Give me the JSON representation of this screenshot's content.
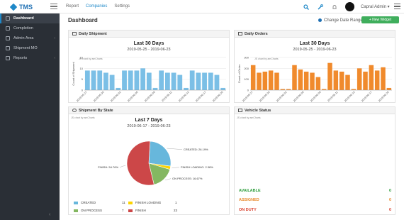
{
  "topbar": {
    "brand": "TMS",
    "nav": [
      "Report",
      "Companies",
      "Settings"
    ],
    "user": "Capral Admin ▾"
  },
  "sidebar": {
    "items": [
      {
        "label": "Dashboard",
        "active": true
      },
      {
        "label": "Completion"
      },
      {
        "label": "Admin Area",
        "chevron": "‹"
      },
      {
        "label": "Shipment MO"
      },
      {
        "label": "Reports",
        "chevron": "‹"
      }
    ],
    "collapse": "‹"
  },
  "header": {
    "title": "Dashboard",
    "date_range": "Change Date Range ▾",
    "new_widget": "+ New Widget"
  },
  "panels": {
    "daily_shipment": {
      "header": "Daily Shipment",
      "title": "Last 30 Days",
      "subtitle": "2019-05-25 - 2019-06-23",
      "credit": "JS chart by amCharts"
    },
    "daily_orders": {
      "header": "Daily Orders",
      "title": "Last 30 Days",
      "subtitle": "2019-05-25 - 2019-06-23",
      "credit": "JS chart by amCharts"
    },
    "shipment_by_state": {
      "header": "Shipment By State",
      "title": "Last 7 Days",
      "subtitle": "2019-06-17 - 2019-06-23",
      "credit": "JS chart by amCharts"
    },
    "vehicle_status": {
      "header": "Vehicle Status",
      "credit": "JS chart by amCharts",
      "rows": [
        {
          "label": "AVAILABLE",
          "value": "0",
          "color": "#2e9e3d"
        },
        {
          "label": "ASSIGNED",
          "value": "0",
          "color": "#e8892b"
        },
        {
          "label": "ON DUTY",
          "value": "0",
          "color": "#d9412e"
        }
      ]
    }
  },
  "chart_data": [
    {
      "type": "bar",
      "ylabel": "Count of Shipment",
      "ylim": [
        0,
        15
      ],
      "yticks": [
        "0",
        "5",
        "10",
        "15"
      ],
      "color": "#7bbfe6",
      "xticks": [
        "2019-05-27",
        "2019-05-30",
        "2019-06-02",
        "2019-06-05",
        "2019-06-08",
        "2019-06-11",
        "2019-06-14",
        "2019-06-17",
        "2019-06-20"
      ],
      "values": [
        9,
        9,
        9,
        8,
        7,
        1,
        9,
        9,
        9,
        10,
        8,
        1,
        9,
        8,
        8,
        7,
        1,
        9,
        8,
        8,
        8,
        7,
        1
      ]
    },
    {
      "type": "bar",
      "ylabel": "Count of Order",
      "ylim": [
        0,
        300
      ],
      "yticks": [
        "0",
        "100",
        "200",
        "300"
      ],
      "color": "#f08a2c",
      "xticks": [
        "2019-05-27",
        "2019-05-30",
        "2019-06-02",
        "2019-06-05",
        "2019-06-08",
        "2019-06-11",
        "2019-06-14",
        "2019-06-17",
        "2019-06-20"
      ],
      "values": [
        230,
        160,
        170,
        180,
        160,
        10,
        10,
        230,
        190,
        170,
        160,
        120,
        10,
        250,
        180,
        170,
        140,
        10,
        200,
        170,
        230,
        180,
        210,
        20
      ]
    },
    {
      "type": "pie",
      "slices": [
        {
          "name": "CREATED",
          "value": 11,
          "label": "CREATED: 26.19%",
          "color": "#67b7dc"
        },
        {
          "name": "FINISH LOADING",
          "value": 1,
          "label": "FINISH LOADING: 2.38%",
          "color": "#fdd400"
        },
        {
          "name": "ON PROCESS",
          "value": 7,
          "label": "ON PROCESS: 16.67%",
          "color": "#84b761"
        },
        {
          "name": "FINISH",
          "value": 23,
          "label": "FINISH: 54.76%",
          "color": "#cc4748"
        }
      ]
    }
  ]
}
